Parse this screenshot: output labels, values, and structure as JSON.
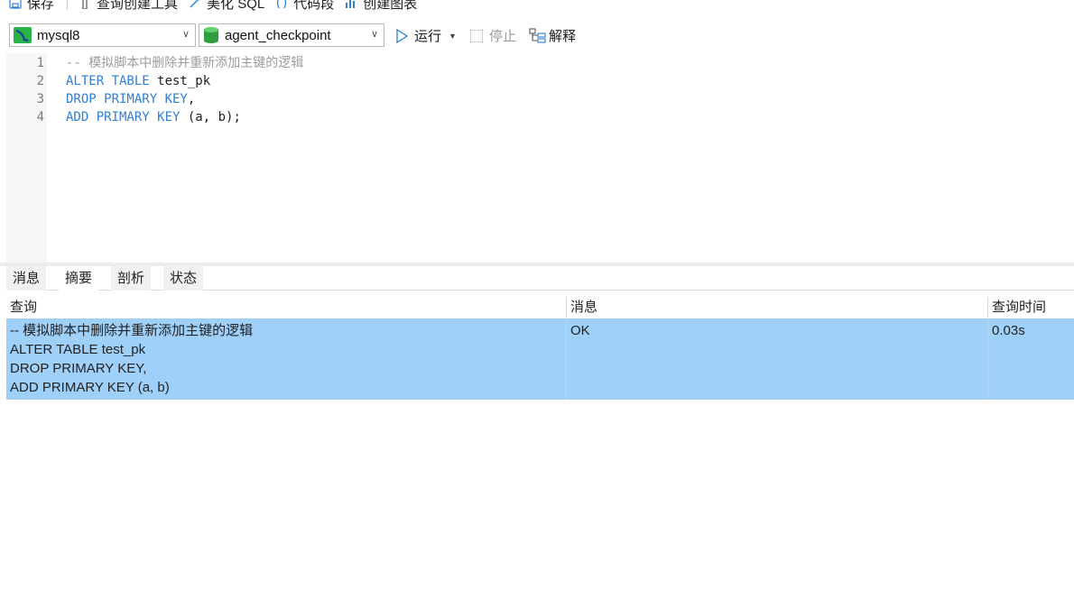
{
  "toolbar": {
    "save": "保存",
    "query_builder": "查询创建工具",
    "beautify": "美化 SQL",
    "snippet": "代码段",
    "create_chart": "创建图表"
  },
  "connection": {
    "name": "mysql8",
    "icon": "mysql-connection-icon"
  },
  "database": {
    "name": "agent_checkpoint",
    "icon": "database-icon"
  },
  "actions": {
    "run": "运行",
    "stop": "停止",
    "explain": "解释"
  },
  "editor": {
    "lines": [
      {
        "num": "1",
        "text": "-- 模拟脚本中删除并重新添加主键的逻辑"
      },
      {
        "num": "2",
        "kw": "ALTER TABLE",
        "rest": " test_pk"
      },
      {
        "num": "3",
        "kw": "DROP PRIMARY KEY",
        "rest": ","
      },
      {
        "num": "4",
        "kw": "ADD PRIMARY KEY",
        "rest": " (a, b);"
      }
    ]
  },
  "tabs": [
    {
      "label": "消息",
      "active": false
    },
    {
      "label": "摘要",
      "active": true
    },
    {
      "label": "剖析",
      "active": false
    },
    {
      "label": "状态",
      "active": false
    }
  ],
  "results": {
    "columns": [
      "查询",
      "消息",
      "查询时间"
    ],
    "rows": [
      {
        "query": "-- 模拟脚本中删除并重新添加主键的逻辑\nALTER TABLE test_pk\nDROP PRIMARY KEY,\nADD PRIMARY KEY (a, b)",
        "message": "OK",
        "time": "0.03s"
      }
    ]
  },
  "colors": {
    "keyword": "#2f7fd6",
    "comment": "#9c9c9c",
    "selected_row": "#9fd0f9",
    "accent": "#2f7fd6"
  }
}
